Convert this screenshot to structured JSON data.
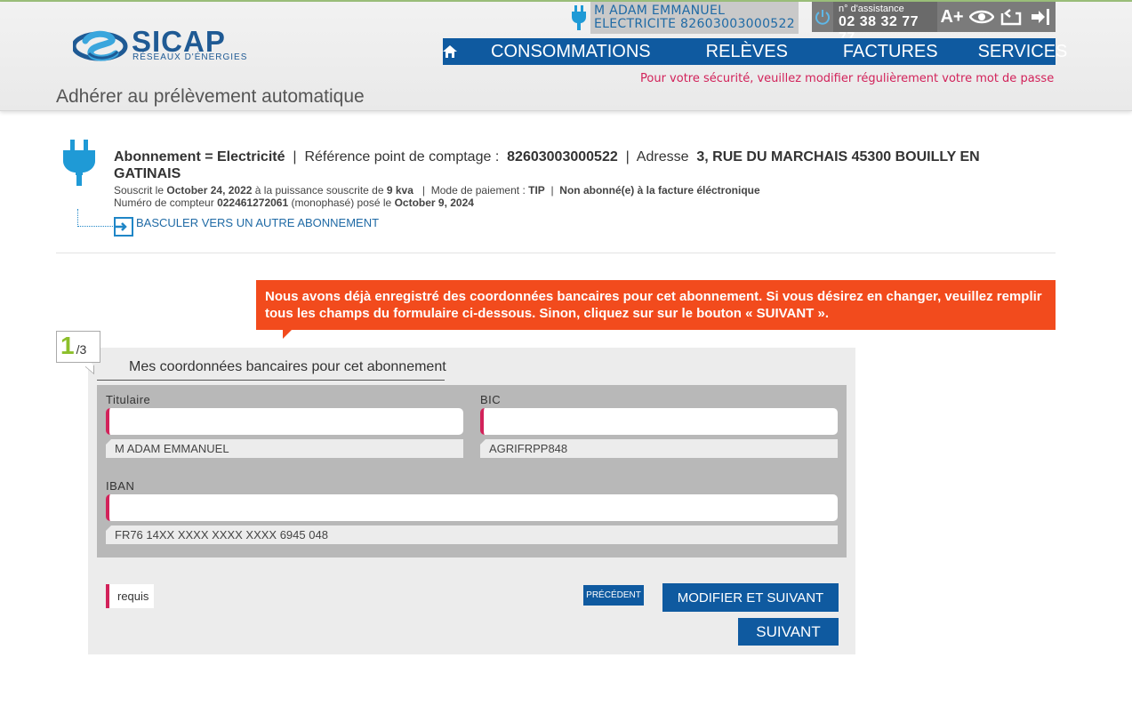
{
  "header": {
    "logo_text": "SICAP",
    "logo_sub": "RÉSEAUX D'ÉNERGIES",
    "page_title": "Adhérer au prélèvement automatique",
    "user_name": "M ADAM EMMANUEL",
    "user_contract": "ELECTRICITE 82603003000522",
    "assist_label": "n° d'assistance",
    "assist_number": "02 38 32 77 77",
    "font_size_label": "A+",
    "security_note": "Pour votre sécurité, veuillez modifier régulièrement votre mot de passe"
  },
  "nav": {
    "items": [
      "CONSOMMATIONS",
      "RELÈVES",
      "FACTURES",
      "SERVICES"
    ]
  },
  "subscription": {
    "type_label": "Abonnement = Electricité",
    "ref_label": "Référence point de comptage :",
    "ref_value": "82603003000522",
    "address_label": "Adresse",
    "address_value": "3, RUE DU MARCHAIS 45300 BOUILLY EN GATINAIS",
    "subscribed_prefix": "Souscrit le",
    "subscribed_date": "October 24, 2022",
    "power_prefix": "à la puissance souscrite de",
    "power_value": "9 kva",
    "payment_prefix": "Mode de paiement :",
    "payment_value": "TIP",
    "einvoice": "Non abonné(e) à la facture éléctronique",
    "meter_prefix": "Numéro de compteur",
    "meter_value": "022461272061",
    "meter_type": "(monophasé) posé le",
    "meter_date": "October 9, 2024",
    "switch_label": "BASCULER VERS UN AUTRE ABONNEMENT"
  },
  "alert": {
    "message": "Nous avons déjà enregistré des coordonnées bancaires pour cet abonnement. Si vous désirez en changer, veuillez remplir tous les champs du formulaire ci-dessous. Sinon, cliquez sur sur le bouton « SUIVANT »."
  },
  "form": {
    "step_current": "1",
    "step_total": "/3",
    "section_title": "Mes coordonnées bancaires pour cet abonnement",
    "titulaire_label": "Titulaire",
    "titulaire_value": "",
    "titulaire_current": "M ADAM EMMANUEL",
    "bic_label": "BIC",
    "bic_value": "",
    "bic_current": "AGRIFRPP848",
    "iban_label": "IBAN",
    "iban_value": "",
    "iban_current": "FR76 14XX XXXX XXXX XXXX 6945 048",
    "required_label": "requis",
    "prev_label": "PRÉCÉDENT",
    "modify_label": "MODIFIER ET SUIVANT",
    "next_label": "SUIVANT"
  },
  "colors": {
    "brand_blue": "#0f5aa0",
    "alert_orange": "#f24b1d",
    "required_red": "#d2225a",
    "step_green": "#8cbf2a"
  }
}
